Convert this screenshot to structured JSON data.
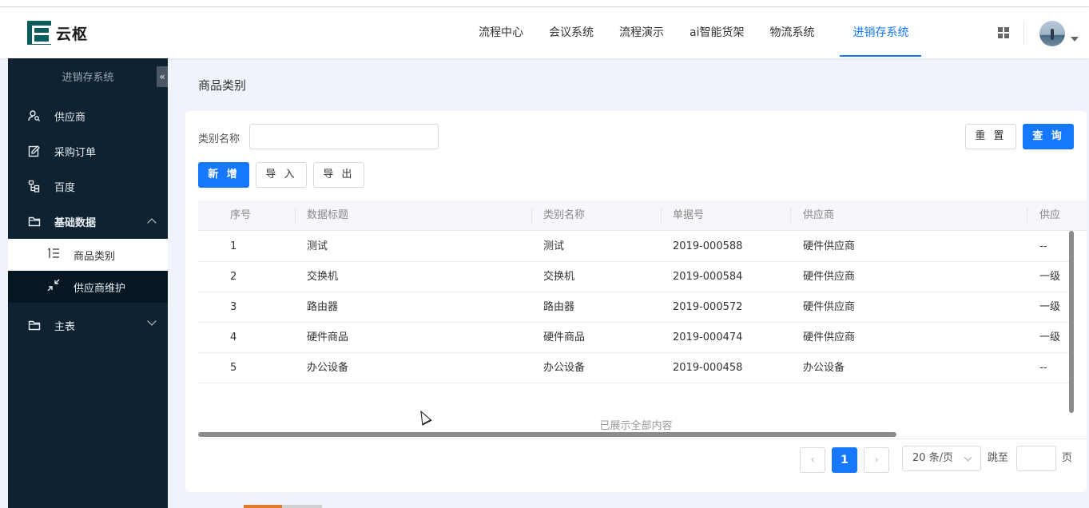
{
  "header": {
    "logo_text": "云枢",
    "nav": [
      "流程中心",
      "会议系统",
      "流程演示",
      "ai智能货架",
      "物流系统",
      "进销存系统"
    ],
    "active_nav": "进销存系统"
  },
  "sidebar": {
    "title": "进销存系统",
    "collapse_glyph": "«",
    "items": [
      {
        "label": "供应商",
        "icon": "user-search-icon"
      },
      {
        "label": "采购订单",
        "icon": "edit-doc-icon"
      },
      {
        "label": "百度",
        "icon": "tree-icon"
      },
      {
        "label": "基础数据",
        "icon": "folder-icon",
        "expanded": true
      },
      {
        "label": "主表",
        "icon": "folder-icon",
        "expanded": false
      }
    ],
    "sub_items": [
      {
        "label": "商品类别",
        "icon": "list-icon",
        "active": true
      },
      {
        "label": "供应商维护",
        "icon": "shrink-icon",
        "active": false
      }
    ]
  },
  "page": {
    "title": "商品类别",
    "filter_label": "类别名称",
    "filter_value": "",
    "reset_label": "重 置",
    "query_label": "查 询",
    "add_label": "新 增",
    "import_label": "导 入",
    "export_label": "导 出"
  },
  "table": {
    "columns": [
      "序号",
      "数据标题",
      "类别名称",
      "单据号",
      "供应商",
      "供应商"
    ],
    "rows": [
      [
        "1",
        "测试",
        "测试",
        "2019-000588",
        "硬件供应商",
        "--"
      ],
      [
        "2",
        "交换机",
        "交换机",
        "2019-000584",
        "硬件供应商",
        "一级"
      ],
      [
        "3",
        "路由器",
        "路由器",
        "2019-000572",
        "硬件供应商",
        "一级"
      ],
      [
        "4",
        "硬件商品",
        "硬件商品",
        "2019-000474",
        "硬件供应商",
        "一级"
      ],
      [
        "5",
        "办公设备",
        "办公设备",
        "2019-000458",
        "办公设备",
        "--"
      ]
    ],
    "footer_note": "已展示全部内容"
  },
  "pagination": {
    "current_page": "1",
    "page_size": "20 条/页",
    "jump_label": "跳至",
    "page_suffix": "页",
    "prev_glyph": "‹",
    "next_glyph": "›"
  }
}
